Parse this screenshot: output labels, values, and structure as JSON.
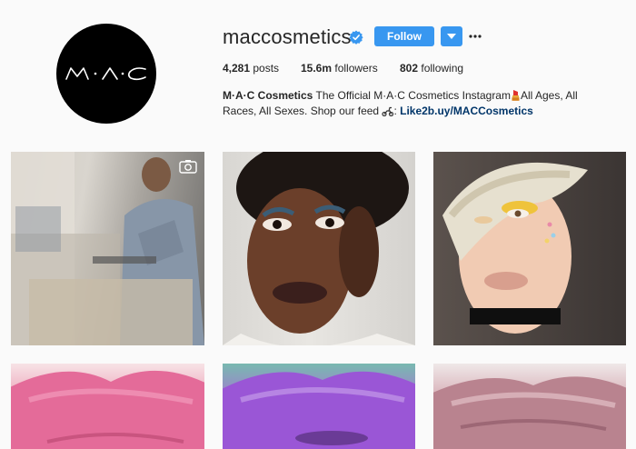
{
  "profile": {
    "username": "maccosmetics",
    "avatar_logo_text": "M·A·C",
    "follow_label": "Follow"
  },
  "icons": {
    "verified": "verified-badge-icon",
    "dropdown": "chevron-down-icon",
    "more": "more-options-icon",
    "camera": "camera-icon"
  },
  "stats": {
    "posts_count": "4,281",
    "posts_label": "posts",
    "followers_count": "15.6m",
    "followers_label": "followers",
    "following_count": "802",
    "following_label": "following"
  },
  "bio": {
    "full_name": "M·A·C Cosmetics",
    "text_1": "The Official M·A·C Cosmetics Instagram",
    "text_2": "All Ages, All Races, All Sexes. Shop our feed",
    "link": "Like2b.uy/MACCosmetics"
  },
  "colors": {
    "accent": "#3897f0",
    "link": "#003569",
    "background": "#fafafa",
    "text": "#262626"
  }
}
